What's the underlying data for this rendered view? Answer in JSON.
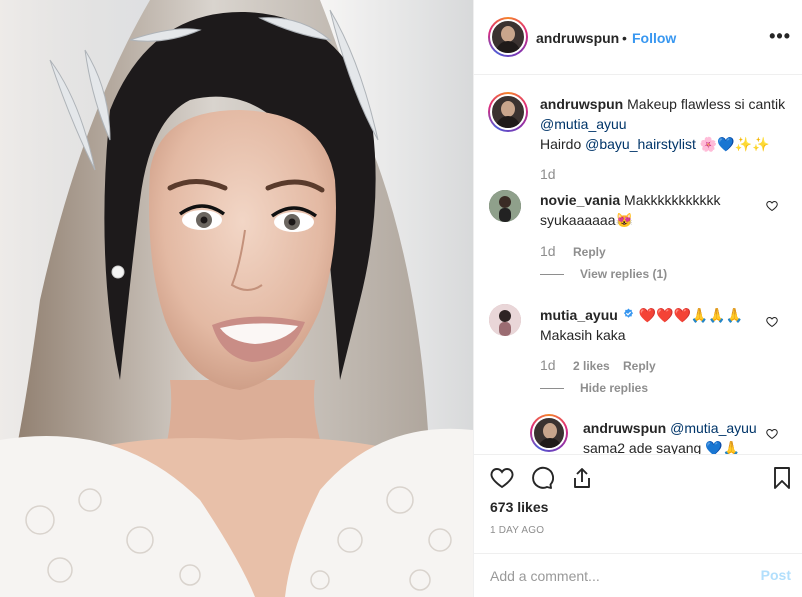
{
  "post": {
    "author": "andruwspun",
    "follow_label": "Follow",
    "separator": "•",
    "more_icon": "more-options-icon"
  },
  "caption": {
    "username": "andruwspun",
    "text_part1": "Makeup flawless si cantik",
    "mention1": "@mutia_ayuu",
    "text_part2": "Hairdo",
    "mention2": "@bayu_hairstylist",
    "emojis": "🌸💙✨✨",
    "age": "1d"
  },
  "comments": [
    {
      "username": "novie_vania",
      "text_line1": "Makkkkkkkkkkk",
      "text_line2": "syukaaaaaa😻",
      "age": "1d",
      "reply_label": "Reply",
      "view_replies_label": "View replies (1)"
    },
    {
      "username": "mutia_ayuu",
      "verified": true,
      "text_line1": "❤️❤️❤️🙏🙏🙏",
      "text_line2": "Makasih kaka",
      "age": "1d",
      "likes_label": "2 likes",
      "reply_label": "Reply",
      "hide_replies_label": "Hide replies"
    },
    {
      "username": "andruwspun",
      "mention": "@mutia_ayuu",
      "text_line2": "sama2 ade sayang 💙🙏"
    }
  ],
  "actions": {
    "likes": "673 likes",
    "time": "1 DAY AGO",
    "comment_placeholder": "Add a comment...",
    "post_label": "Post"
  },
  "colors": {
    "link": "#3897f0",
    "mention": "#003569",
    "muted": "#8e8e8e",
    "post_disabled": "#b2dffc",
    "verified": "#3897f0"
  }
}
